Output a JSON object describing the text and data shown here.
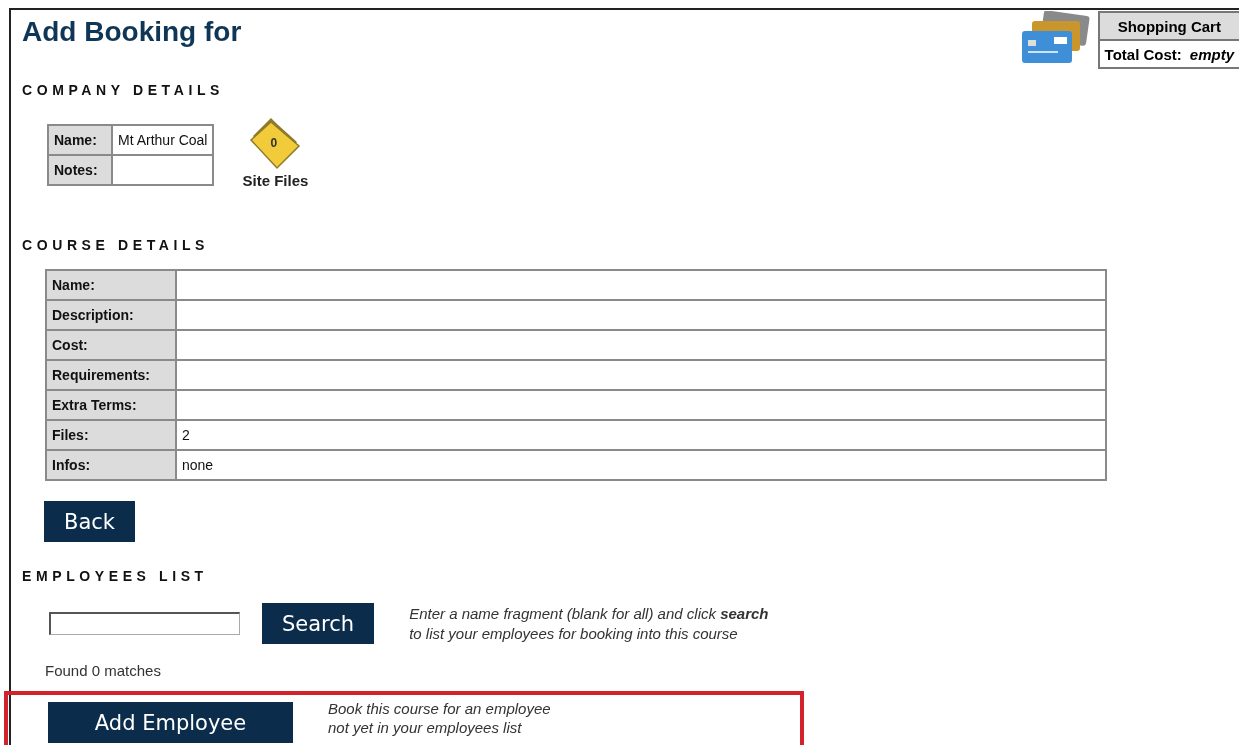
{
  "title": "Add Booking for",
  "cart": {
    "heading": "Shopping Cart",
    "label": "Total Cost:",
    "value": "empty"
  },
  "company": {
    "heading": "COMPANY DETAILS",
    "fields": [
      {
        "label": "Name:",
        "value": "Mt Arthur Coal"
      },
      {
        "label": "Notes:"
      }
    ],
    "site_files": {
      "count": "0",
      "label": "Site Files"
    }
  },
  "course": {
    "heading": "COURSE DETAILS",
    "fields": [
      {
        "label": "Name:"
      },
      {
        "label": "Description:"
      },
      {
        "label": "Cost:"
      },
      {
        "label": "Requirements:"
      },
      {
        "label": "Extra Terms:"
      },
      {
        "label": "Files:",
        "value": "2"
      },
      {
        "label": "Infos:",
        "value": "none"
      }
    ],
    "back_button": "Back"
  },
  "employees": {
    "heading": "EMPLOYEES LIST",
    "search_button": "Search",
    "help": "Enter a name fragment (blank for all) and click **search**",
    "help_line2": "to list your employees for booking into this course",
    "result": "Found 0 matches",
    "add_button": "Add Employee",
    "add_help": "Book this course for an employee",
    "add_help_line2": "not yet in your employees list"
  }
}
